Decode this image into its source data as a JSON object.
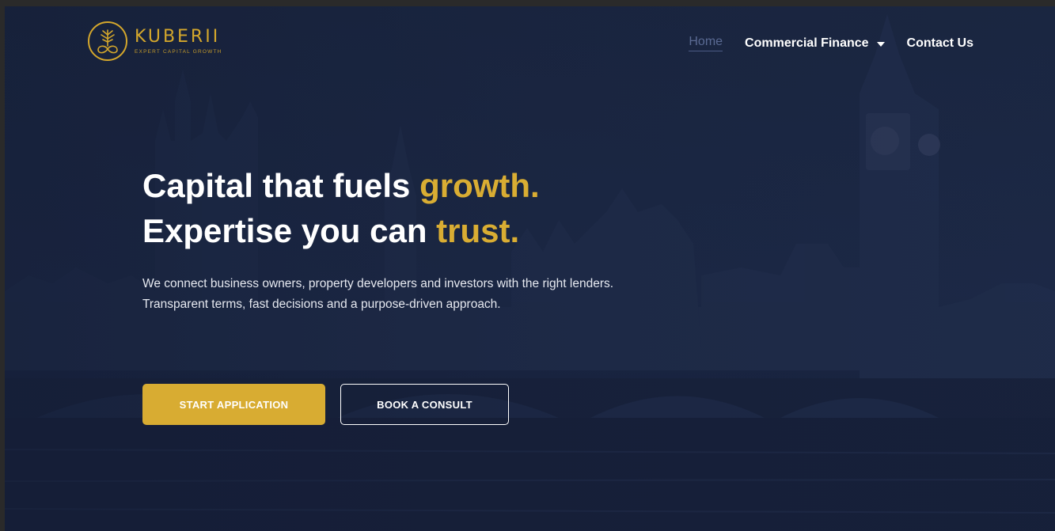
{
  "brand": {
    "name": "KUBERII",
    "tagline": "EXPERT CAPITAL GROWTH",
    "logo_icon": "tree-infinity-emblem-icon",
    "color": "#d4a72c"
  },
  "nav": {
    "items": [
      {
        "label": "Home",
        "active": true
      },
      {
        "label": "Commercial Finance",
        "has_dropdown": true
      },
      {
        "label": "Contact Us"
      }
    ]
  },
  "hero": {
    "line1_prefix": "Capital that fuels ",
    "line1_accent": "growth.",
    "line2_prefix": "Expertise you can ",
    "line2_accent": "trust.",
    "sub_line1": "We connect business owners, property developers and investors with the right lenders.",
    "sub_line2": "Transparent terms, fast decisions and a purpose-driven approach."
  },
  "buttons": {
    "primary_label": "START APPLICATION",
    "secondary_label": "BOOK A CONSULT"
  },
  "colors": {
    "accent": "#d9ad33",
    "background": "#1c2844"
  }
}
